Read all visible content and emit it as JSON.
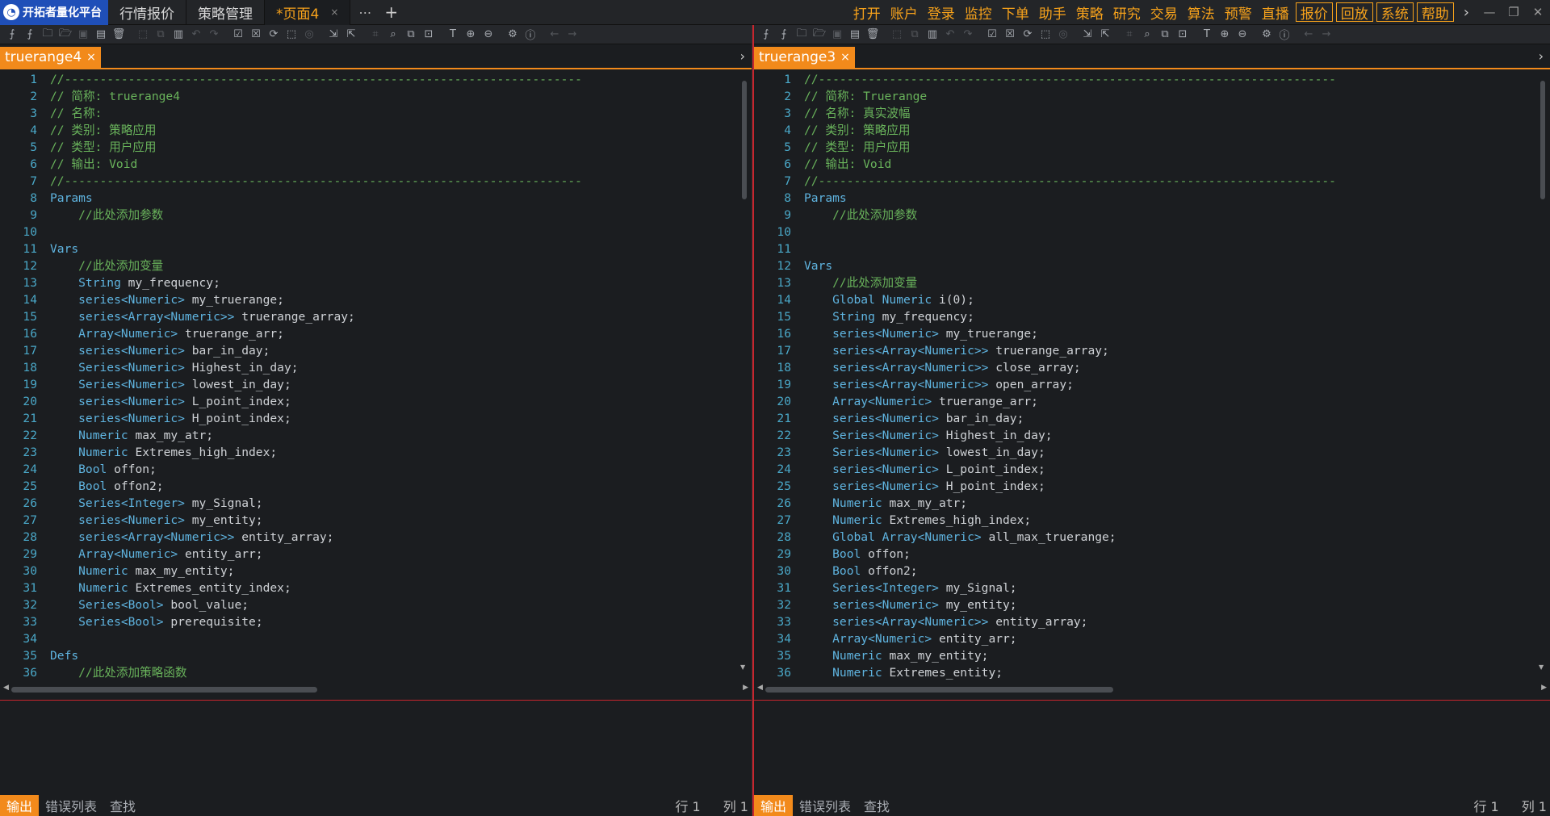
{
  "app": {
    "name": "开拓者量化平台",
    "tabs": [
      {
        "label": "行情报价"
      },
      {
        "label": "策略管理"
      },
      {
        "label": "*页面4"
      }
    ]
  },
  "menu": {
    "items": [
      "打开",
      "账户",
      "登录",
      "监控",
      "下单",
      "助手",
      "策略",
      "研究",
      "交易",
      "算法",
      "预警",
      "直播"
    ],
    "boxed": [
      "报价",
      "回放",
      "系统",
      "帮助"
    ]
  },
  "toolbar_icons": [
    "new-file-icon",
    "new-file-plus-icon",
    "open-folder-icon",
    "open-file-icon",
    "save-icon",
    "save-all-icon",
    "delete-icon",
    "cut-icon",
    "copy-icon",
    "paste-icon",
    "undo-icon",
    "redo-icon",
    "check-icon",
    "compile-icon",
    "refresh-icon",
    "select-icon",
    "target-icon",
    "import-icon",
    "export-icon",
    "crop-icon",
    "search-icon",
    "replace-icon",
    "find-file-icon",
    "text-icon",
    "zoom-in-icon",
    "zoom-out-icon",
    "settings-icon",
    "info-icon",
    "back-arrow-icon",
    "forward-arrow-icon"
  ],
  "left": {
    "file": "truerange4",
    "scroll": {
      "vertical": 0.2,
      "horizontal": 0.42
    },
    "lines": [
      [
        [
          "comment",
          "//-------------------------------------------------------------------------"
        ]
      ],
      [
        [
          "comment",
          "// 简称: truerange4"
        ]
      ],
      [
        [
          "comment",
          "// 名称:"
        ]
      ],
      [
        [
          "comment",
          "// 类别: 策略应用"
        ]
      ],
      [
        [
          "comment",
          "// 类型: 用户应用"
        ]
      ],
      [
        [
          "comment",
          "// 输出: Void"
        ]
      ],
      [
        [
          "comment",
          "//-------------------------------------------------------------------------"
        ]
      ],
      [
        [
          "keyword",
          "Params"
        ]
      ],
      [
        [
          "comment",
          "    //此处添加参数"
        ]
      ],
      [],
      [
        [
          "keyword",
          "Vars"
        ]
      ],
      [
        [
          "comment",
          "    //此处添加变量"
        ]
      ],
      [
        [
          "keyword",
          "    String"
        ],
        [
          "text",
          " my_frequency;"
        ]
      ],
      [
        [
          "keyword",
          "    series<Numeric>"
        ],
        [
          "text",
          " my_truerange;"
        ]
      ],
      [
        [
          "keyword",
          "    series<Array<Numeric>>"
        ],
        [
          "text",
          " truerange_array;"
        ]
      ],
      [
        [
          "keyword",
          "    Array<Numeric>"
        ],
        [
          "text",
          " truerange_arr;"
        ]
      ],
      [
        [
          "keyword",
          "    series<Numeric>"
        ],
        [
          "text",
          " bar_in_day;"
        ]
      ],
      [
        [
          "keyword",
          "    Series<Numeric>"
        ],
        [
          "text",
          " Highest_in_day;"
        ]
      ],
      [
        [
          "keyword",
          "    Series<Numeric>"
        ],
        [
          "text",
          " lowest_in_day;"
        ]
      ],
      [
        [
          "keyword",
          "    series<Numeric>"
        ],
        [
          "text",
          " L_point_index;"
        ]
      ],
      [
        [
          "keyword",
          "    series<Numeric>"
        ],
        [
          "text",
          " H_point_index;"
        ]
      ],
      [
        [
          "keyword",
          "    Numeric"
        ],
        [
          "text",
          " max_my_atr;"
        ]
      ],
      [
        [
          "keyword",
          "    Numeric"
        ],
        [
          "text",
          " Extremes_high_index;"
        ]
      ],
      [
        [
          "keyword",
          "    Bool"
        ],
        [
          "text",
          " offon;"
        ]
      ],
      [
        [
          "keyword",
          "    Bool"
        ],
        [
          "text",
          " offon2;"
        ]
      ],
      [
        [
          "keyword",
          "    Series<Integer>"
        ],
        [
          "text",
          " my_Signal;"
        ]
      ],
      [
        [
          "keyword",
          "    series<Numeric>"
        ],
        [
          "text",
          " my_entity;"
        ]
      ],
      [
        [
          "keyword",
          "    series<Array<Numeric>>"
        ],
        [
          "text",
          " entity_array;"
        ]
      ],
      [
        [
          "keyword",
          "    Array<Numeric>"
        ],
        [
          "text",
          " entity_arr;"
        ]
      ],
      [
        [
          "keyword",
          "    Numeric"
        ],
        [
          "text",
          " max_my_entity;"
        ]
      ],
      [
        [
          "keyword",
          "    Numeric"
        ],
        [
          "text",
          " Extremes_entity_index;"
        ]
      ],
      [
        [
          "keyword",
          "    Series<Bool>"
        ],
        [
          "text",
          " bool_value;"
        ]
      ],
      [
        [
          "keyword",
          "    Series<Bool>"
        ],
        [
          "text",
          " prerequisite;"
        ]
      ],
      [],
      [
        [
          "keyword",
          "Defs"
        ]
      ],
      [
        [
          "comment",
          "    //此处添加策略函数"
        ]
      ]
    ],
    "status": {
      "tabs": [
        "输出",
        "错误列表",
        "查找"
      ],
      "row": "行 1",
      "col": "列 1"
    }
  },
  "right": {
    "file": "truerange3",
    "scroll": {
      "vertical": 0.2,
      "horizontal": 0.45
    },
    "lines": [
      [
        [
          "comment",
          "//-------------------------------------------------------------------------"
        ]
      ],
      [
        [
          "comment",
          "// 简称: Truerange"
        ]
      ],
      [
        [
          "comment",
          "// 名称: 真实波幅"
        ]
      ],
      [
        [
          "comment",
          "// 类别: 策略应用"
        ]
      ],
      [
        [
          "comment",
          "// 类型: 用户应用"
        ]
      ],
      [
        [
          "comment",
          "// 输出: Void"
        ]
      ],
      [
        [
          "comment",
          "//-------------------------------------------------------------------------"
        ]
      ],
      [
        [
          "keyword",
          "Params"
        ]
      ],
      [
        [
          "comment",
          "    //此处添加参数"
        ]
      ],
      [],
      [],
      [
        [
          "keyword",
          "Vars"
        ]
      ],
      [
        [
          "comment",
          "    //此处添加变量"
        ]
      ],
      [
        [
          "keyword",
          "    Global Numeric"
        ],
        [
          "text",
          " i(0);"
        ]
      ],
      [
        [
          "keyword",
          "    String"
        ],
        [
          "text",
          " my_frequency;"
        ]
      ],
      [
        [
          "keyword",
          "    series<Numeric>"
        ],
        [
          "text",
          " my_truerange;"
        ]
      ],
      [
        [
          "keyword",
          "    series<Array<Numeric>>"
        ],
        [
          "text",
          " truerange_array;"
        ]
      ],
      [
        [
          "keyword",
          "    series<Array<Numeric>>"
        ],
        [
          "text",
          " close_array;"
        ]
      ],
      [
        [
          "keyword",
          "    series<Array<Numeric>>"
        ],
        [
          "text",
          " open_array;"
        ]
      ],
      [
        [
          "keyword",
          "    Array<Numeric>"
        ],
        [
          "text",
          " truerange_arr;"
        ]
      ],
      [
        [
          "keyword",
          "    series<Numeric>"
        ],
        [
          "text",
          " bar_in_day;"
        ]
      ],
      [
        [
          "keyword",
          "    Series<Numeric>"
        ],
        [
          "text",
          " Highest_in_day;"
        ]
      ],
      [
        [
          "keyword",
          "    Series<Numeric>"
        ],
        [
          "text",
          " lowest_in_day;"
        ]
      ],
      [
        [
          "keyword",
          "    series<Numeric>"
        ],
        [
          "text",
          " L_point_index;"
        ]
      ],
      [
        [
          "keyword",
          "    series<Numeric>"
        ],
        [
          "text",
          " H_point_index;"
        ]
      ],
      [
        [
          "keyword",
          "    Numeric"
        ],
        [
          "text",
          " max_my_atr;"
        ]
      ],
      [
        [
          "keyword",
          "    Numeric"
        ],
        [
          "text",
          " Extremes_high_index;"
        ]
      ],
      [
        [
          "keyword",
          "    Global Array<Numeric>"
        ],
        [
          "text",
          " all_max_truerange;"
        ]
      ],
      [
        [
          "keyword",
          "    Bool"
        ],
        [
          "text",
          " offon;"
        ]
      ],
      [
        [
          "keyword",
          "    Bool"
        ],
        [
          "text",
          " offon2;"
        ]
      ],
      [
        [
          "keyword",
          "    Series<Integer>"
        ],
        [
          "text",
          " my_Signal;"
        ]
      ],
      [
        [
          "keyword",
          "    series<Numeric>"
        ],
        [
          "text",
          " my_entity;"
        ]
      ],
      [
        [
          "keyword",
          "    series<Array<Numeric>>"
        ],
        [
          "text",
          " entity_array;"
        ]
      ],
      [
        [
          "keyword",
          "    Array<Numeric>"
        ],
        [
          "text",
          " entity_arr;"
        ]
      ],
      [
        [
          "keyword",
          "    Numeric"
        ],
        [
          "text",
          " max_my_entity;"
        ]
      ],
      [
        [
          "keyword",
          "    Numeric"
        ],
        [
          "text",
          " Extremes_entity;"
        ]
      ]
    ],
    "status": {
      "tabs": [
        "输出",
        "错误列表",
        "查找"
      ],
      "row": "行 1",
      "col": "列 1"
    }
  }
}
